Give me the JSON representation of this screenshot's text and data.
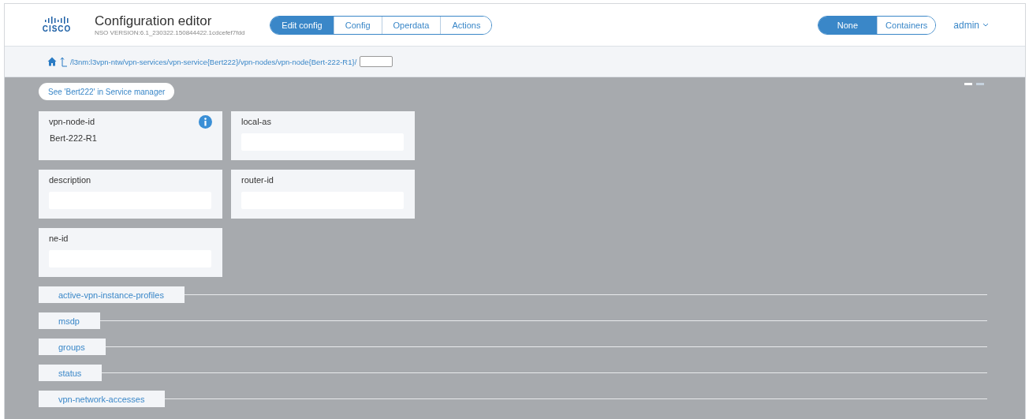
{
  "header": {
    "logo_text": "CISCO",
    "title": "Configuration editor",
    "version": "NSO VERSION:6.1_230322.150844422.1cdcefef7fdd",
    "mode_tabs": [
      {
        "label": "Edit config",
        "selected": true
      },
      {
        "label": "Config",
        "selected": false
      },
      {
        "label": "Operdata",
        "selected": false
      },
      {
        "label": "Actions",
        "selected": false
      }
    ],
    "view_tabs": [
      {
        "label": "None",
        "selected": true
      },
      {
        "label": "Containers",
        "selected": false
      }
    ],
    "user": "admin"
  },
  "path_bar": {
    "path": "/l3nm:l3vpn-ntw/vpn-services/vpn-service{Bert222}/vpn-nodes/vpn-node{Bert-222-R1}/"
  },
  "service_link": "See 'Bert222' in Service manager",
  "page_dots": [
    {
      "selected": true
    },
    {
      "selected": false
    }
  ],
  "leaves": [
    {
      "label": "vpn-node-id",
      "kind": "value",
      "value": "Bert-222-R1",
      "info": true
    },
    {
      "label": "local-as",
      "kind": "input",
      "info": false
    },
    {
      "label": "description",
      "kind": "input",
      "info": false
    },
    {
      "label": "router-id",
      "kind": "input",
      "info": false
    },
    {
      "label": "ne-id",
      "kind": "input",
      "info": false
    }
  ],
  "containers": [
    {
      "label": "active-vpn-instance-profiles"
    },
    {
      "label": "msdp"
    },
    {
      "label": "groups"
    },
    {
      "label": "status"
    },
    {
      "label": "vpn-network-accesses"
    }
  ]
}
